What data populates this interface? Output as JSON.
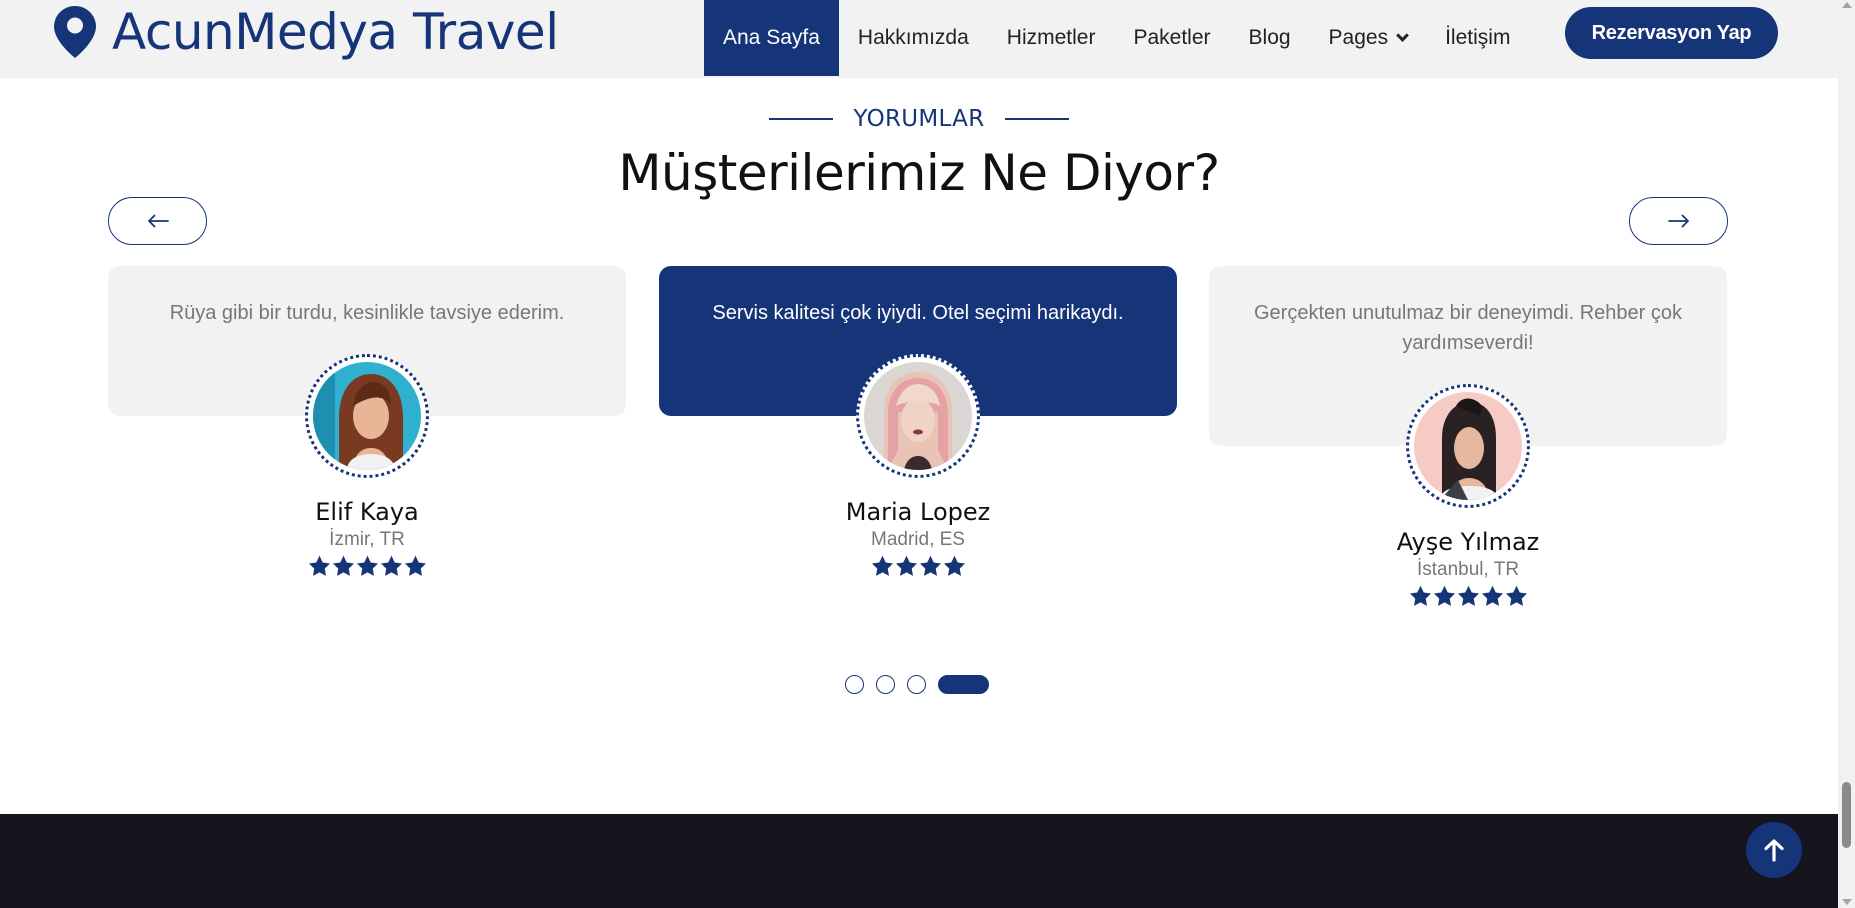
{
  "brand": {
    "name": "AcunMedya Travel",
    "icon": "map-pin-icon"
  },
  "nav": {
    "items": [
      {
        "label": "Ana Sayfa",
        "active": true
      },
      {
        "label": "Hakkımızda"
      },
      {
        "label": "Hizmetler"
      },
      {
        "label": "Paketler"
      },
      {
        "label": "Blog"
      },
      {
        "label": "Pages",
        "has_dropdown": true
      },
      {
        "label": "İletişim"
      }
    ],
    "cta_label": "Rezervasyon Yap"
  },
  "section": {
    "eyebrow": "YORUMLAR",
    "title": "Müşterilerimiz Ne Diyor?",
    "prev_icon": "arrow-left-icon",
    "next_icon": "arrow-right-icon"
  },
  "testimonials": [
    {
      "quote": "Rüya gibi bir turdu, kesinlikle tavsiye ederim.",
      "name": "Elif Kaya",
      "location": "İzmir, TR",
      "rating": 5,
      "featured": false
    },
    {
      "quote": "Servis kalitesi çok iyiydi. Otel seçimi harikaydı.",
      "name": "Maria Lopez",
      "location": "Madrid, ES",
      "rating": 4,
      "featured": true
    },
    {
      "quote": "Gerçekten unutulmaz bir deneyimdi. Rehber çok yardımseverdi!",
      "name": "Ayşe Yılmaz",
      "location": "İstanbul, TR",
      "rating": 5,
      "featured": false
    }
  ],
  "pagination": {
    "count": 4,
    "active_index": 3
  },
  "back_to_top_icon": "arrow-up-icon",
  "colors": {
    "primary": "#163579",
    "navbar_bg": "#f2f2f2",
    "card_bg": "#f2f2f2",
    "footer_bg": "#15141f",
    "star": "#163579"
  }
}
